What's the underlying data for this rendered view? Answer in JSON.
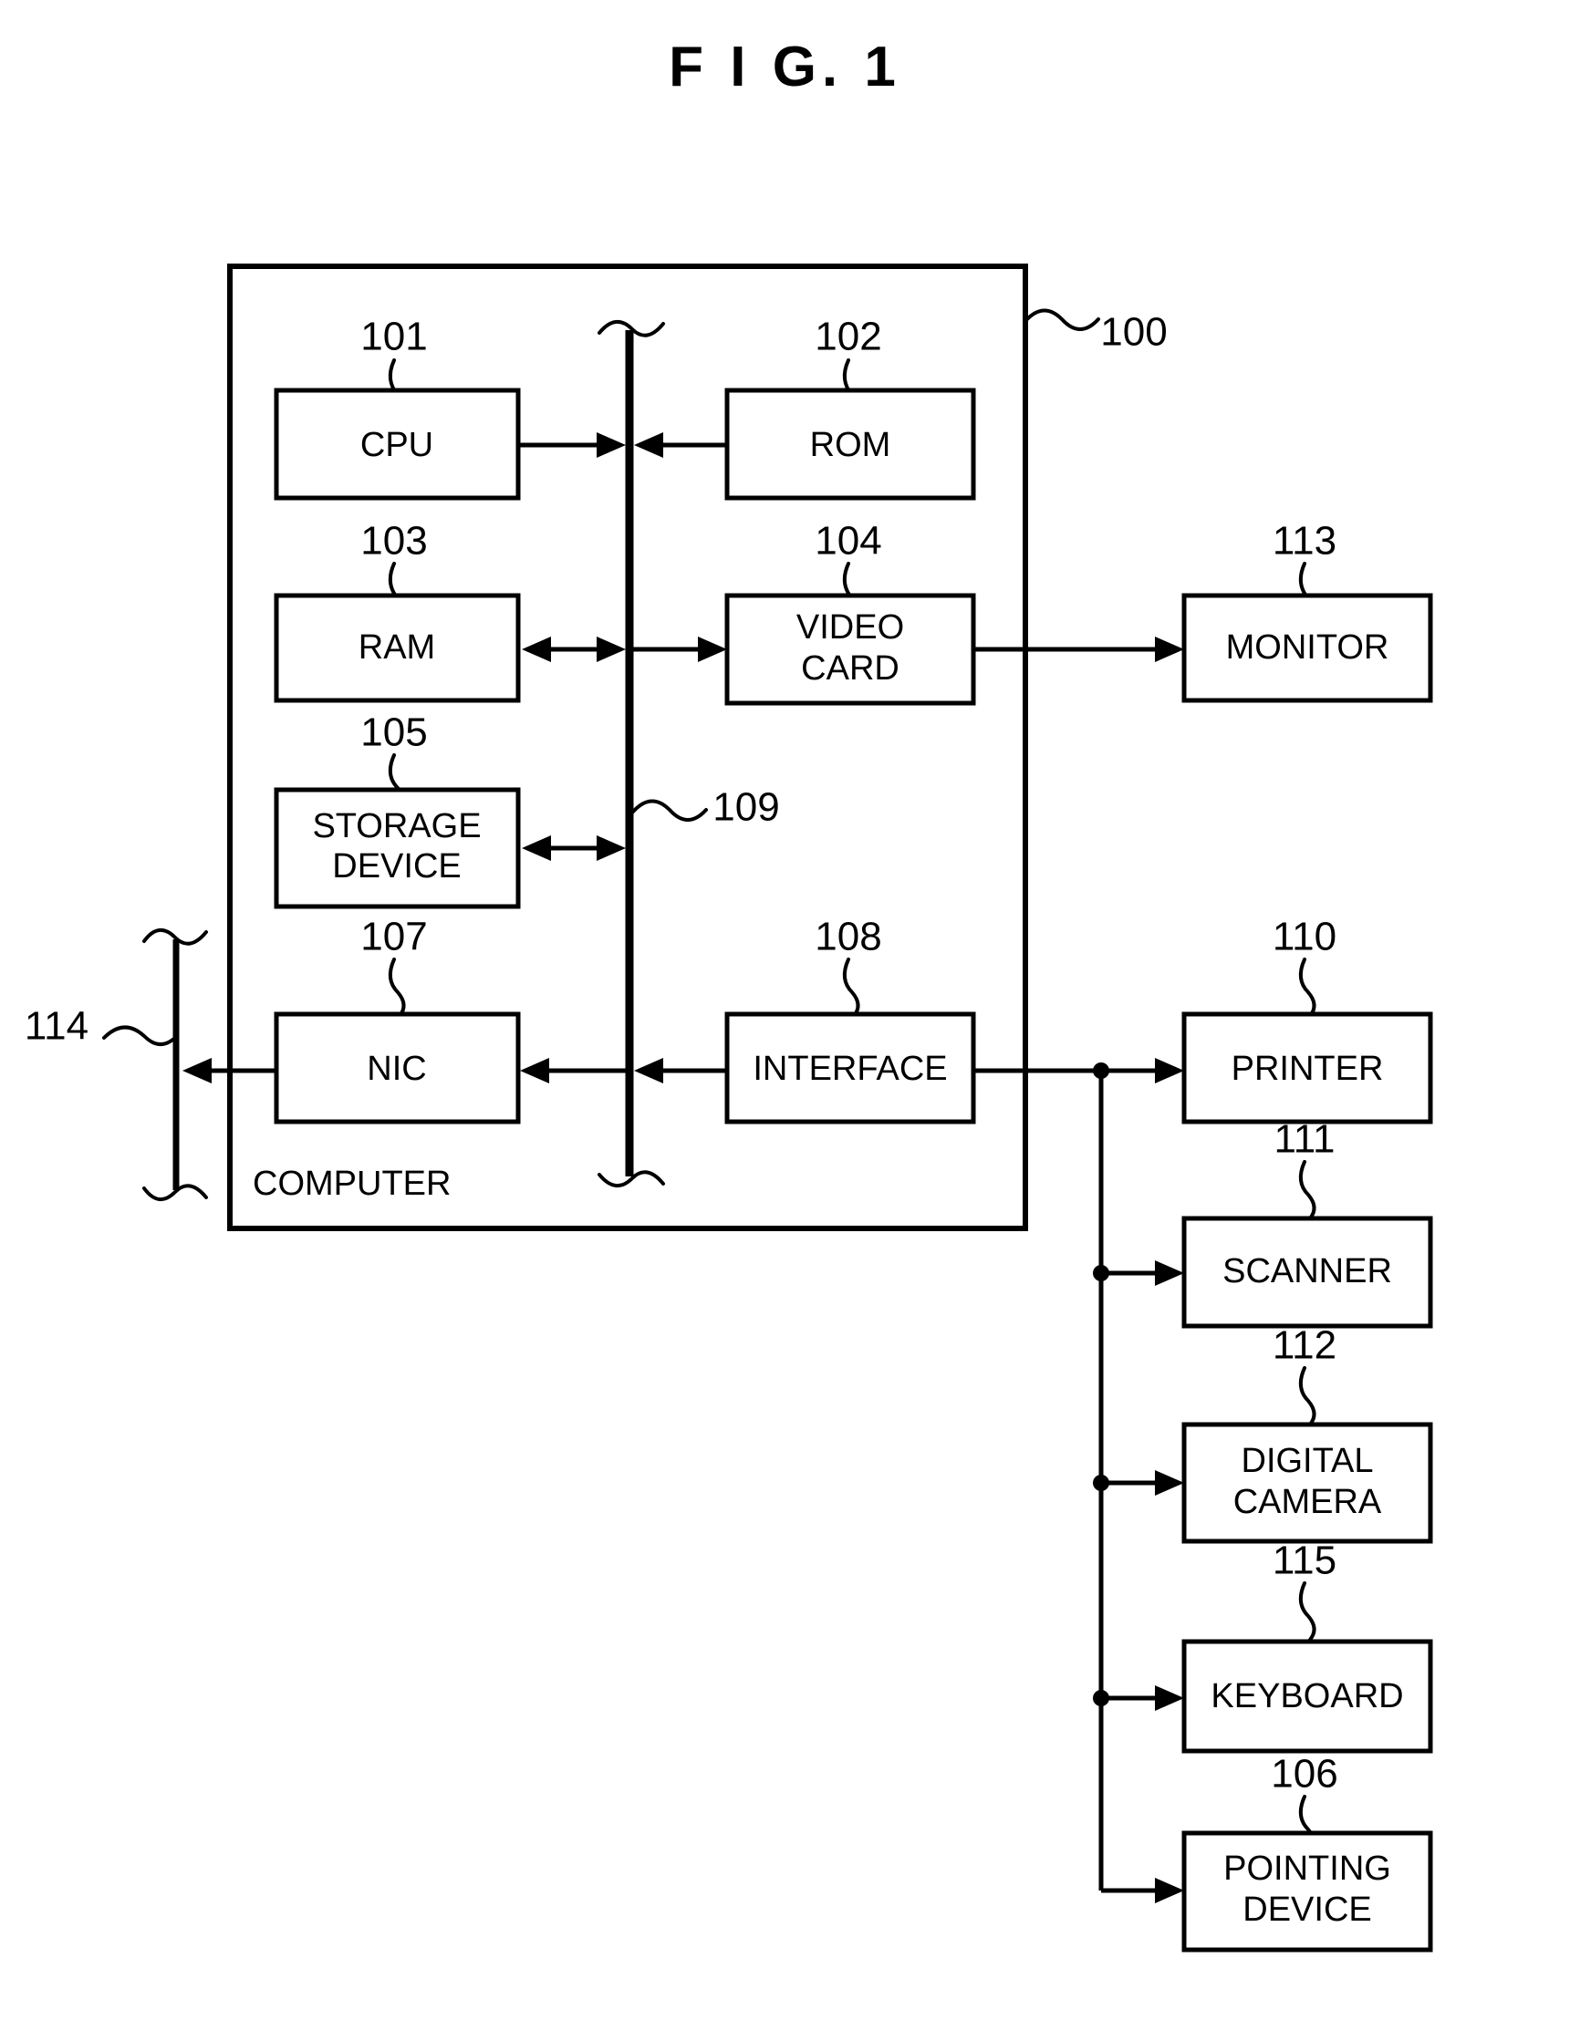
{
  "figure": {
    "title": "F I G. 1",
    "system_label": "COMPUTER",
    "system_ref": "100"
  },
  "refs": {
    "cpu": "101",
    "rom": "102",
    "ram": "103",
    "video_card": "104",
    "storage_device": "105",
    "pointing_device": "106",
    "nic": "107",
    "interface": "108",
    "bus": "109",
    "printer": "110",
    "scanner": "111",
    "digital_camera": "112",
    "monitor": "113",
    "network": "114",
    "keyboard": "115"
  },
  "blocks": {
    "cpu": "CPU",
    "rom": "ROM",
    "ram": "RAM",
    "video_card_line1": "VIDEO",
    "video_card_line2": "CARD",
    "storage_device_line1": "STORAGE",
    "storage_device_line2": "DEVICE",
    "nic": "NIC",
    "interface": "INTERFACE",
    "monitor": "MONITOR",
    "printer": "PRINTER",
    "scanner": "SCANNER",
    "digital_camera_line1": "DIGITAL",
    "digital_camera_line2": "CAMERA",
    "keyboard": "KEYBOARD",
    "pointing_device_line1": "POINTING",
    "pointing_device_line2": "DEVICE"
  },
  "colors": {
    "ink": "#000000",
    "paper": "#ffffff"
  }
}
